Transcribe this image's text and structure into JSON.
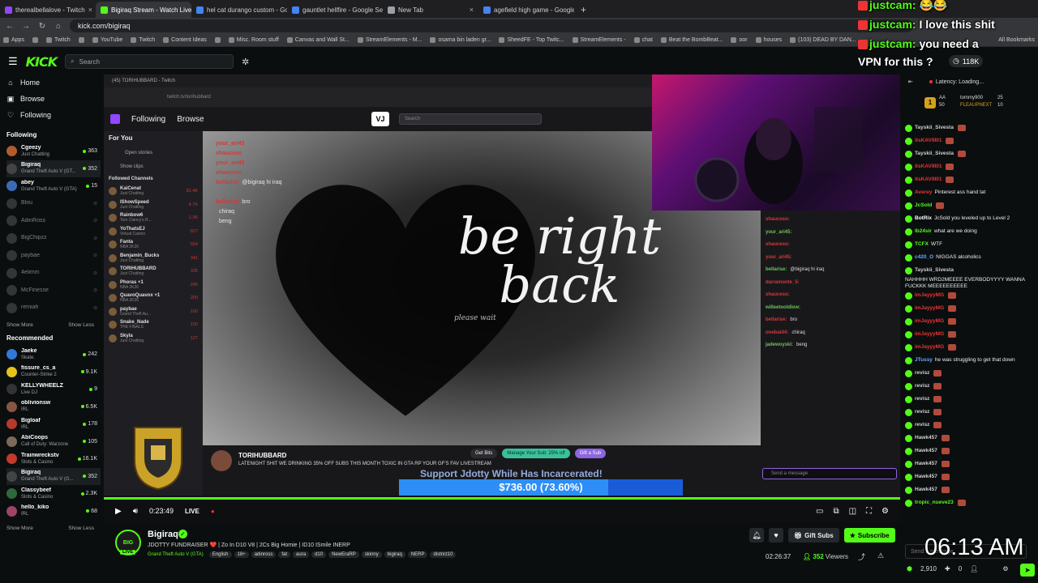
{
  "browser": {
    "tabs": [
      {
        "title": "therealbellalove - Twitch",
        "color": "#9146ff",
        "active": false
      },
      {
        "title": "Bigiraq Stream - Watch Live on",
        "color": "#53fc18",
        "active": true
      },
      {
        "title": "hel cat durango custom - Goog",
        "color": "#4285f4",
        "active": false
      },
      {
        "title": "gauntlet hellfire - Google Sear",
        "color": "#4285f4",
        "active": false
      },
      {
        "title": "New Tab",
        "color": "#9aa0a6",
        "active": false
      },
      {
        "title": "agefield high game - Google S",
        "color": "#4285f4",
        "active": false
      }
    ],
    "url": "kick.com/bigiraq",
    "bookmarks": [
      "Apps",
      "",
      "Twitch",
      "",
      "YouTube",
      "Twitch",
      "Content Ideas",
      "",
      "Misc. Room stuff",
      "Canvas and Wall St...",
      "StreamElements - M...",
      "osama bin laden gr...",
      "SheedFE - Top Twitc...",
      "StreamElements -",
      "chat",
      "Beat the BombBeat...",
      "oor",
      "houses",
      "(103) DEAD BY DAN..."
    ],
    "all_bookmarks": "All Bookmarks"
  },
  "header": {
    "logo": "KICK",
    "search_placeholder": "Search"
  },
  "sidebar": {
    "nav": [
      {
        "label": "Home",
        "icon": "home-icon",
        "glyph": "⌂"
      },
      {
        "label": "Browse",
        "icon": "browse-icon",
        "glyph": "▣"
      },
      {
        "label": "Following",
        "icon": "heart-icon",
        "glyph": "♡"
      }
    ],
    "following_title": "Following",
    "following": [
      {
        "name": "Cgeezy",
        "game": "Just Chatting",
        "viewers": "363",
        "color": "#b25c2d",
        "online": true
      },
      {
        "name": "Bigiraq",
        "game": "Grand Theft Auto V (GT...",
        "viewers": "352",
        "color": "#444",
        "online": true,
        "selected": true
      },
      {
        "name": "abey",
        "game": "Grand Theft Auto V (GTA)",
        "viewers": "15",
        "color": "#3b6bb5",
        "online": true
      },
      {
        "name": "Blou",
        "game": "",
        "viewers": "",
        "color": "#666",
        "online": false
      },
      {
        "name": "AdinRoss",
        "game": "",
        "viewers": "",
        "color": "#666",
        "online": false
      },
      {
        "name": "BigChipzz",
        "game": "",
        "viewers": "",
        "color": "#666",
        "online": false
      },
      {
        "name": "paybae",
        "game": "",
        "viewers": "",
        "color": "#666",
        "online": false
      },
      {
        "name": "4elimm",
        "game": "",
        "viewers": "",
        "color": "#666",
        "online": false
      },
      {
        "name": "McFinesse",
        "game": "",
        "viewers": "",
        "color": "#666",
        "online": false
      },
      {
        "name": "remiah",
        "game": "",
        "viewers": "",
        "color": "#666",
        "online": false
      }
    ],
    "show_more": "Show More",
    "show_less": "Show Less",
    "recommended_title": "Recommended",
    "recommended": [
      {
        "name": "Jaeke",
        "game": "Skate.",
        "viewers": "242",
        "color": "#3178d8"
      },
      {
        "name": "fissure_cs_a",
        "game": "Counter-Strike 2",
        "viewers": "9.1K",
        "color": "#e6c21a"
      },
      {
        "name": "KELLYWHEELZ",
        "game": "Live DJ",
        "viewers": "9",
        "color": "#333"
      },
      {
        "name": "oblivionsw",
        "game": "IRL",
        "viewers": "6.5K",
        "color": "#885544"
      },
      {
        "name": "Bigloaf",
        "game": "IRL",
        "viewers": "178",
        "color": "#b53a2b"
      },
      {
        "name": "AbiCoops",
        "game": "Call of Duty: Warzone",
        "viewers": "105",
        "color": "#7a6a5a"
      },
      {
        "name": "Trainwreckstv",
        "game": "Slots & Casino",
        "viewers": "16.1K",
        "color": "#c23a2b"
      },
      {
        "name": "Bigiraq",
        "game": "Grand Theft Auto V (G...",
        "viewers": "352",
        "color": "#444",
        "selected": true
      },
      {
        "name": "Classybeef",
        "game": "Slots & Casino",
        "viewers": "2.3K",
        "color": "#2d6a3a"
      },
      {
        "name": "hello_kiko",
        "game": "IRL",
        "viewers": "68",
        "color": "#a04466"
      }
    ]
  },
  "video": {
    "inner_tab": "(45) TORIHUBBARD - Twitch",
    "inner_url": "twitch.tv/torihubbard",
    "tw_nav": [
      "Following",
      "Browse"
    ],
    "tw_search": "Search",
    "for_you": "For You",
    "open_stories": "Open stories",
    "show_clips": "Show clips",
    "followed_channels": "Followed Channels",
    "tw_channels": [
      {
        "name": "KaiCenat",
        "game": "Just Chatting",
        "v": "82.4K"
      },
      {
        "name": "IShowSpeed",
        "game": "Just Chatting",
        "v": "4.7K"
      },
      {
        "name": "Rainbow6",
        "game": "Tom Clancy's R...",
        "v": "1.3K"
      },
      {
        "name": "YoThatsEJ",
        "game": "Virtual Casino",
        "v": "827"
      },
      {
        "name": "Fanta",
        "game": "NBA 2K26",
        "v": "654"
      },
      {
        "name": "Benjamin_Bucks",
        "game": "Just Chatting",
        "v": "341"
      },
      {
        "name": "TORIHUBBARD",
        "game": "Just Chatting",
        "v": "335"
      },
      {
        "name": "Phoras +1",
        "game": "NBA 2K26",
        "v": "245"
      },
      {
        "name": "QuavoQuavox +1",
        "game": "NBA 2K26",
        "v": "200"
      },
      {
        "name": "paybae",
        "game": "Grand Theft Au...",
        "v": "160"
      },
      {
        "name": "Snake_Nade",
        "game": "THE FINALS",
        "v": "150"
      },
      {
        "name": "Skyla",
        "game": "Just Chatting",
        "v": "127"
      }
    ],
    "brb_line1": "be right",
    "brb_line2": "back",
    "please_wait": "please wait",
    "overlay_chat": [
      {
        "u": "your_ari45",
        "t": ""
      },
      {
        "u": "shauceso",
        "t": ""
      },
      {
        "u": "your_ari45",
        "t": ""
      },
      {
        "u": "shauceso",
        "t": ""
      },
      {
        "u": "bellarise",
        "t": "@bigiraq hi iraq"
      },
      {
        "u": "",
        "t": ""
      },
      {
        "u": "bellarise",
        "t": "bro"
      },
      {
        "u": "",
        "t": "chiraq"
      },
      {
        "u": "",
        "t": "beng"
      }
    ],
    "tw_chat": [
      {
        "u": "shauceso:",
        "t": ""
      },
      {
        "u": "your_ari45:",
        "t": ""
      },
      {
        "u": "shauceso:",
        "t": ""
      },
      {
        "u": "your_ari45:",
        "t": ""
      },
      {
        "u": "bellarise:",
        "t": "@bigiraq hi iraq"
      },
      {
        "u": "darramonte_5:",
        "t": ""
      },
      {
        "u": "shauceso:",
        "t": ""
      },
      {
        "u": "willeetooldlow:",
        "t": ""
      },
      {
        "u": "bellarise:",
        "t": "bro"
      },
      {
        "u": "onebaid4:",
        "t": "chiraq"
      },
      {
        "u": "jadewoyski:",
        "t": "beng"
      }
    ],
    "tw_send_placeholder": "Send a message",
    "tw_streamer": "TORIHUBBARD",
    "tw_title": "LATENIGHT SHIT WE DRINKING 35% OFF SUBS THIS MONTH TOXIC IN GTA RP YOUR GF'S FAV LIVESTREAM",
    "tw_btn_bits": "Get Bits",
    "tw_btn_sub": "Manage Your Sub: 25% off",
    "tw_btn_gift": "Gift a Sub",
    "support_text": "Support Jdotty While Has Incarcerated!",
    "fund_text": "$736.00 (73.60%)",
    "fund_fraction": 0.736
  },
  "controls": {
    "time": "0:23:49",
    "live": "LIVE"
  },
  "stream": {
    "avatar_text": "BIG",
    "live_pill": "LIVE",
    "name": "Bigiraq",
    "title": "JDOTTY FUNDRAISER ❤️ | Zo In D10 V8 | 2Cs Big Homie | ID10 ISmile INERP",
    "game": "Grand Theft Auto V (GTA)",
    "tags": [
      "English",
      "18+",
      "adinross",
      "fat",
      "aura",
      "d10",
      "NewEraRP",
      "skinny",
      "bigiraq",
      "NERP",
      "district10"
    ],
    "gift_subs": "Gift Subs",
    "subscribe": "Subscribe",
    "uptime": "02:26:37",
    "viewers": "352",
    "viewers_label": "Viewers"
  },
  "chat": {
    "latency": "Latency: Loading...",
    "leaderboard": [
      {
        "name": "AA",
        "value": "50"
      },
      {
        "name": "tommy900",
        "value": "25"
      },
      {
        "name": "FLEAUPNEXT",
        "value": "10"
      }
    ],
    "messages": [
      {
        "u": "Tayskii_Sivesta",
        "t": "",
        "c": "#cfcfcf"
      },
      {
        "u": "itsKAVIII01",
        "t": "",
        "c": "#e33"
      },
      {
        "u": "Tayskii_Sivesta",
        "t": "",
        "c": "#cfcfcf"
      },
      {
        "u": "itsKAVIII01",
        "t": "",
        "c": "#e33"
      },
      {
        "u": "itsKAVIII01",
        "t": "",
        "c": "#e33"
      },
      {
        "u": "Averey",
        "t": "Pinterest ass hand tat",
        "c": "#e33"
      },
      {
        "u": "JcSold",
        "t": "",
        "c": "#53fc18"
      },
      {
        "u": "BotRix",
        "t": "JcSold you leveled up to Level 2",
        "c": "#fff"
      },
      {
        "u": "lb24sir",
        "t": "what are we doing",
        "c": "#53fc18"
      },
      {
        "u": "TCFX",
        "t": "WTF",
        "c": "#53fc18"
      },
      {
        "u": "c420_O",
        "t": "NIGGAS alcoholics",
        "c": "#6aa9ff"
      },
      {
        "u": "Tayskii_Sivesta",
        "t": "NAHHHH WRD2MEEEE EVERBODYYYY WANNA FUCKKK MEEEEEEEEEE",
        "c": "#cfcfcf"
      },
      {
        "u": "imJayyyMG",
        "t": "",
        "c": "#e33"
      },
      {
        "u": "imJayyyMG",
        "t": "",
        "c": "#e33"
      },
      {
        "u": "imJayyyMG",
        "t": "",
        "c": "#e33"
      },
      {
        "u": "imJayyyMG",
        "t": "",
        "c": "#e33"
      },
      {
        "u": "imJayyyMG",
        "t": "",
        "c": "#e33"
      },
      {
        "u": "JTussy",
        "t": "he was struggling to get that down",
        "c": "#6aa9ff"
      },
      {
        "u": "revisz",
        "t": "",
        "c": "#cfcfcf"
      },
      {
        "u": "revisz",
        "t": "",
        "c": "#cfcfcf"
      },
      {
        "u": "revisz",
        "t": "",
        "c": "#cfcfcf"
      },
      {
        "u": "revisz",
        "t": "",
        "c": "#cfcfcf"
      },
      {
        "u": "revisz",
        "t": "",
        "c": "#cfcfcf"
      },
      {
        "u": "Hawk457",
        "t": "",
        "c": "#cfcfcf"
      },
      {
        "u": "Hawk457",
        "t": "",
        "c": "#cfcfcf"
      },
      {
        "u": "Hawk457",
        "t": "",
        "c": "#cfcfcf"
      },
      {
        "u": "Hawk457",
        "t": "",
        "c": "#cfcfcf"
      },
      {
        "u": "Hawk457",
        "t": "",
        "c": "#cfcfcf"
      },
      {
        "u": "tropic_nueve23",
        "t": "",
        "c": "#53fc18"
      }
    ],
    "input_placeholder": "Send a message",
    "points": "2,910",
    "zero": "0"
  },
  "overlay": {
    "msg1_user": "justcam:",
    "msg1_text": "😂😂",
    "msg2_user": "justcam:",
    "msg2_text": "I love this shit",
    "msg3_user": "justcam:",
    "msg3_text": "you need a",
    "msg4_text": "VPN for this ?",
    "viewcount": "118K",
    "clock": "06:13 AM"
  },
  "colors": {
    "kick_green": "#53fc18",
    "background": "#0b0e0f"
  }
}
